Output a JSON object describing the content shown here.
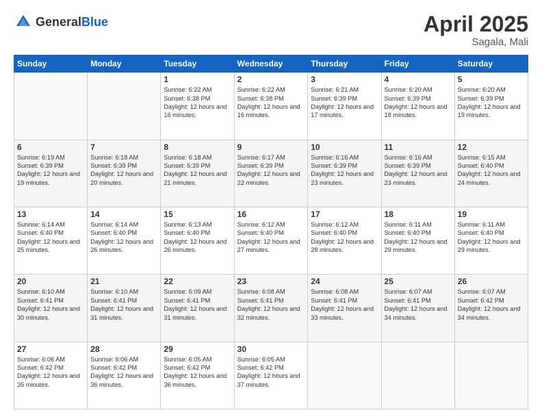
{
  "header": {
    "logo_general": "General",
    "logo_blue": "Blue",
    "month": "April 2025",
    "location": "Sagala, Mali"
  },
  "weekdays": [
    "Sunday",
    "Monday",
    "Tuesday",
    "Wednesday",
    "Thursday",
    "Friday",
    "Saturday"
  ],
  "weeks": [
    [
      {
        "day": "",
        "info": ""
      },
      {
        "day": "",
        "info": ""
      },
      {
        "day": "1",
        "info": "Sunrise: 6:22 AM\nSunset: 6:38 PM\nDaylight: 12 hours and 16 minutes."
      },
      {
        "day": "2",
        "info": "Sunrise: 6:22 AM\nSunset: 6:38 PM\nDaylight: 12 hours and 16 minutes."
      },
      {
        "day": "3",
        "info": "Sunrise: 6:21 AM\nSunset: 6:39 PM\nDaylight: 12 hours and 17 minutes."
      },
      {
        "day": "4",
        "info": "Sunrise: 6:20 AM\nSunset: 6:39 PM\nDaylight: 12 hours and 18 minutes."
      },
      {
        "day": "5",
        "info": "Sunrise: 6:20 AM\nSunset: 6:39 PM\nDaylight: 12 hours and 19 minutes."
      }
    ],
    [
      {
        "day": "6",
        "info": "Sunrise: 6:19 AM\nSunset: 6:39 PM\nDaylight: 12 hours and 19 minutes."
      },
      {
        "day": "7",
        "info": "Sunrise: 6:18 AM\nSunset: 6:39 PM\nDaylight: 12 hours and 20 minutes."
      },
      {
        "day": "8",
        "info": "Sunrise: 6:18 AM\nSunset: 6:39 PM\nDaylight: 12 hours and 21 minutes."
      },
      {
        "day": "9",
        "info": "Sunrise: 6:17 AM\nSunset: 6:39 PM\nDaylight: 12 hours and 22 minutes."
      },
      {
        "day": "10",
        "info": "Sunrise: 6:16 AM\nSunset: 6:39 PM\nDaylight: 12 hours and 23 minutes."
      },
      {
        "day": "11",
        "info": "Sunrise: 6:16 AM\nSunset: 6:39 PM\nDaylight: 12 hours and 23 minutes."
      },
      {
        "day": "12",
        "info": "Sunrise: 6:15 AM\nSunset: 6:40 PM\nDaylight: 12 hours and 24 minutes."
      }
    ],
    [
      {
        "day": "13",
        "info": "Sunrise: 6:14 AM\nSunset: 6:40 PM\nDaylight: 12 hours and 25 minutes."
      },
      {
        "day": "14",
        "info": "Sunrise: 6:14 AM\nSunset: 6:40 PM\nDaylight: 12 hours and 26 minutes."
      },
      {
        "day": "15",
        "info": "Sunrise: 6:13 AM\nSunset: 6:40 PM\nDaylight: 12 hours and 26 minutes."
      },
      {
        "day": "16",
        "info": "Sunrise: 6:12 AM\nSunset: 6:40 PM\nDaylight: 12 hours and 27 minutes."
      },
      {
        "day": "17",
        "info": "Sunrise: 6:12 AM\nSunset: 6:40 PM\nDaylight: 12 hours and 28 minutes."
      },
      {
        "day": "18",
        "info": "Sunrise: 6:11 AM\nSunset: 6:40 PM\nDaylight: 12 hours and 29 minutes."
      },
      {
        "day": "19",
        "info": "Sunrise: 6:11 AM\nSunset: 6:40 PM\nDaylight: 12 hours and 29 minutes."
      }
    ],
    [
      {
        "day": "20",
        "info": "Sunrise: 6:10 AM\nSunset: 6:41 PM\nDaylight: 12 hours and 30 minutes."
      },
      {
        "day": "21",
        "info": "Sunrise: 6:10 AM\nSunset: 6:41 PM\nDaylight: 12 hours and 31 minutes."
      },
      {
        "day": "22",
        "info": "Sunrise: 6:09 AM\nSunset: 6:41 PM\nDaylight: 12 hours and 31 minutes."
      },
      {
        "day": "23",
        "info": "Sunrise: 6:08 AM\nSunset: 6:41 PM\nDaylight: 12 hours and 32 minutes."
      },
      {
        "day": "24",
        "info": "Sunrise: 6:08 AM\nSunset: 6:41 PM\nDaylight: 12 hours and 33 minutes."
      },
      {
        "day": "25",
        "info": "Sunrise: 6:07 AM\nSunset: 6:41 PM\nDaylight: 12 hours and 34 minutes."
      },
      {
        "day": "26",
        "info": "Sunrise: 6:07 AM\nSunset: 6:42 PM\nDaylight: 12 hours and 34 minutes."
      }
    ],
    [
      {
        "day": "27",
        "info": "Sunrise: 6:06 AM\nSunset: 6:42 PM\nDaylight: 12 hours and 35 minutes."
      },
      {
        "day": "28",
        "info": "Sunrise: 6:06 AM\nSunset: 6:42 PM\nDaylight: 12 hours and 36 minutes."
      },
      {
        "day": "29",
        "info": "Sunrise: 6:05 AM\nSunset: 6:42 PM\nDaylight: 12 hours and 36 minutes."
      },
      {
        "day": "30",
        "info": "Sunrise: 6:05 AM\nSunset: 6:42 PM\nDaylight: 12 hours and 37 minutes."
      },
      {
        "day": "",
        "info": ""
      },
      {
        "day": "",
        "info": ""
      },
      {
        "day": "",
        "info": ""
      }
    ]
  ]
}
